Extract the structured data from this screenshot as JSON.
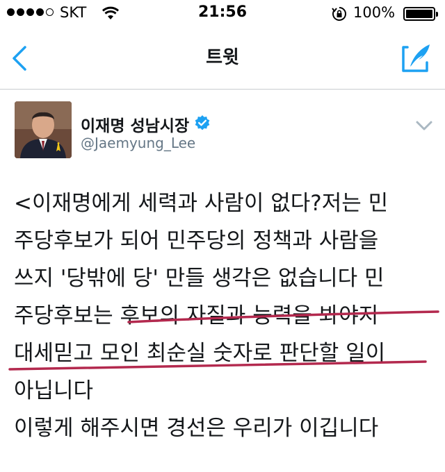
{
  "status_bar": {
    "carrier": "SKT",
    "time": "21:56",
    "battery": "100%",
    "signal_bars_filled": 4,
    "signal_bars_total": 5
  },
  "nav": {
    "title": "트윗",
    "back_icon": "chevron-left-icon",
    "compose_icon": "compose-quill-icon"
  },
  "tweet": {
    "display_name": "이재명 성남시장",
    "username": "@Jaemyung_Lee",
    "verified": true,
    "lines": [
      "<이재명에게 세력과 사람이 없다?저는 민",
      "주당후보가 되어 민주당의 정책과 사람을",
      "쓰지 '당밖에 당' 만들 생각은 없습니다 민",
      "주당후보는 후보의 자질과 능력을 봐야지",
      "대세믿고 모인 최순실 숫자로 판단할 일이",
      "아닙니다",
      "이렇게 해주시면 경선은 우리가 이깁니다"
    ]
  },
  "colors": {
    "accent": "#1da1f2",
    "text": "#14171a",
    "secondary": "#657786",
    "annotation": "#b3294e"
  }
}
